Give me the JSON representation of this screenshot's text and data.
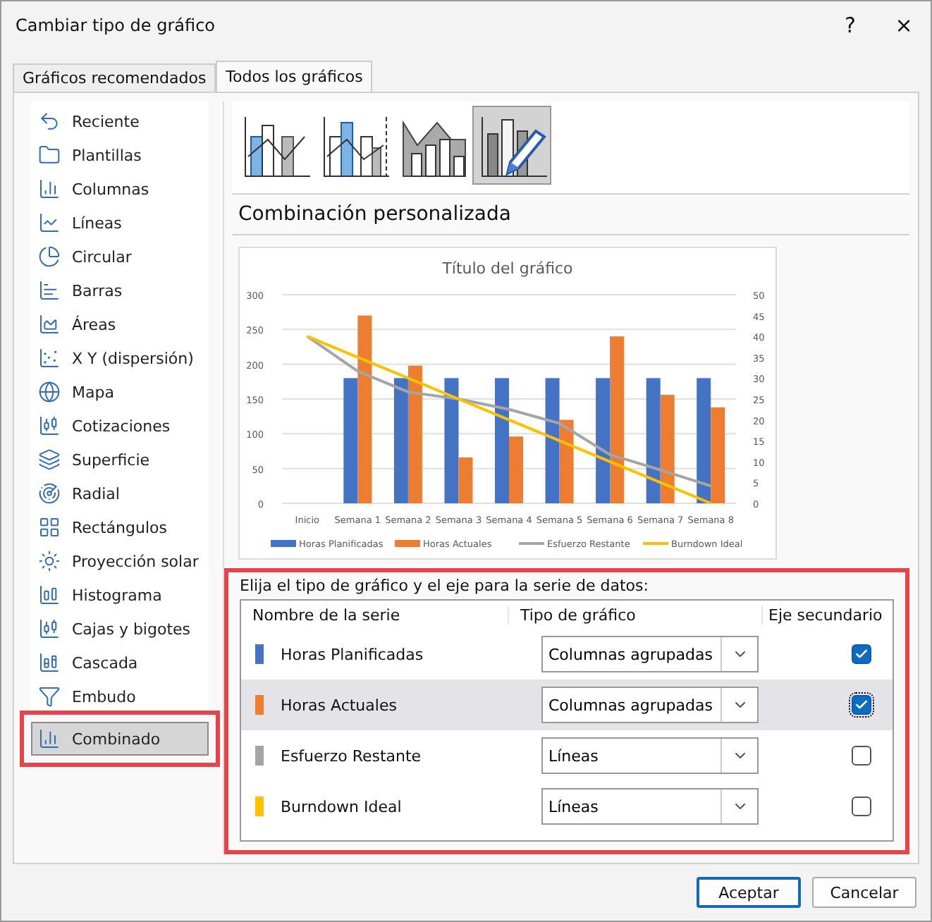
{
  "window": {
    "title": "Cambiar tipo de gráfico",
    "help": "?",
    "close": "×"
  },
  "tabs": [
    {
      "label": "Gráficos recomendados",
      "selected": false
    },
    {
      "label": "Todos los gráficos",
      "selected": true
    }
  ],
  "sidebar": {
    "items": [
      {
        "label": "Reciente",
        "selected": false
      },
      {
        "label": "Plantillas",
        "selected": false
      },
      {
        "label": "Columnas",
        "selected": false
      },
      {
        "label": "Líneas",
        "selected": false
      },
      {
        "label": "Circular",
        "selected": false
      },
      {
        "label": "Barras",
        "selected": false
      },
      {
        "label": "Áreas",
        "selected": false
      },
      {
        "label": "X Y (dispersión)",
        "selected": false
      },
      {
        "label": "Mapa",
        "selected": false
      },
      {
        "label": "Cotizaciones",
        "selected": false
      },
      {
        "label": "Superficie",
        "selected": false
      },
      {
        "label": "Radial",
        "selected": false
      },
      {
        "label": "Rectángulos",
        "selected": false
      },
      {
        "label": "Proyección solar",
        "selected": false
      },
      {
        "label": "Histograma",
        "selected": false
      },
      {
        "label": "Cajas y bigotes",
        "selected": false
      },
      {
        "label": "Cascada",
        "selected": false
      },
      {
        "label": "Embudo",
        "selected": false
      },
      {
        "label": "Combinado",
        "selected": true
      }
    ]
  },
  "subtypes": [
    {
      "selected": false
    },
    {
      "selected": false
    },
    {
      "selected": false
    },
    {
      "selected": true
    }
  ],
  "heading": "Combinación personalizada",
  "preview": {
    "chart_data": {
      "type": "bar",
      "title": "Título del gráfico",
      "categories": [
        "Inicio",
        "Semana 1",
        "Semana 2",
        "Semana 3",
        "Semana 4",
        "Semana 5",
        "Semana 6",
        "Semana 7",
        "Semana 8"
      ],
      "ylim": [
        0,
        300
      ],
      "yticks": [
        0,
        50,
        100,
        150,
        200,
        250,
        300
      ],
      "y2lim": [
        0,
        50
      ],
      "y2ticks": [
        0,
        5,
        10,
        15,
        20,
        25,
        30,
        35,
        40,
        45,
        50
      ],
      "stacked": false,
      "grid": true,
      "legend": true,
      "series": [
        {
          "name": "Horas Planificadas",
          "color": "#4472c4",
          "type": "bar",
          "axis": "y2",
          "values": [
            null,
            30,
            30,
            30,
            30,
            30,
            30,
            30,
            30
          ]
        },
        {
          "name": "Horas Actuales",
          "color": "#ed7d31",
          "type": "bar",
          "axis": "y2",
          "values": [
            null,
            45,
            33,
            11,
            16,
            20,
            40,
            26,
            23
          ]
        },
        {
          "name": "Esfuerzo Restante",
          "color": "#a5a5a5",
          "type": "line",
          "values": [
            240,
            190,
            160,
            150,
            135,
            115,
            70,
            48,
            25
          ]
        },
        {
          "name": "Burndown Ideal",
          "color": "#ffc000",
          "type": "line",
          "values": [
            240,
            210,
            180,
            150,
            120,
            90,
            60,
            30,
            0
          ]
        }
      ]
    }
  },
  "series_table": {
    "prompt": "Elija el tipo de gráfico y el eje para la serie de datos:",
    "columns": [
      "Nombre de la serie",
      "Tipo de gráfico",
      "Eje secundario"
    ],
    "rows": [
      {
        "name": "Horas Planificadas",
        "color": "#4472c4",
        "chart_type": "Columnas agrupadas",
        "secondary": true,
        "selected": false
      },
      {
        "name": "Horas Actuales",
        "color": "#ed7d31",
        "chart_type": "Columnas agrupadas",
        "secondary": true,
        "selected": true
      },
      {
        "name": "Esfuerzo Restante",
        "color": "#a5a5a5",
        "chart_type": "Líneas",
        "secondary": false,
        "selected": false
      },
      {
        "name": "Burndown Ideal",
        "color": "#ffc000",
        "chart_type": "Líneas",
        "secondary": false,
        "selected": false
      }
    ]
  },
  "buttons": [
    {
      "label": "Aceptar",
      "default": true
    },
    {
      "label": "Cancelar",
      "default": false
    }
  ]
}
